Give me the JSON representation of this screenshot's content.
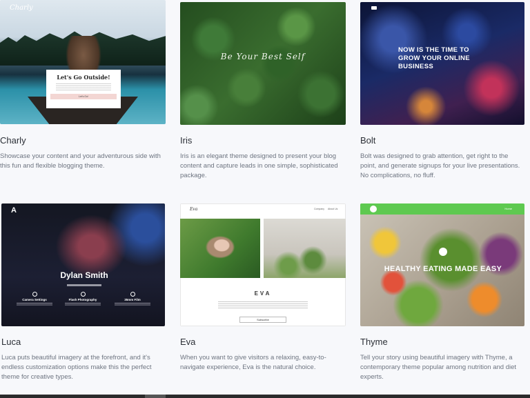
{
  "themes": [
    {
      "name": "Charly",
      "description": "Showcase your content and your adventurous side with this fun and flexible blogging theme.",
      "preview": {
        "logo": "Charly",
        "headline": "Let's Go Outside!",
        "button": "Let's Go!"
      }
    },
    {
      "name": "Iris",
      "description": "Iris is an elegant theme designed to present your blog content and capture leads in one simple, sophisticated package.",
      "preview": {
        "headline": "Be Your Best Self"
      }
    },
    {
      "name": "Bolt",
      "description": "Bolt was designed to grab attention, get right to the point, and generate signups for your live presentations. No complications, no fluff.",
      "preview": {
        "headline": "NOW IS THE TIME TO GROW YOUR ONLINE BUSINESS"
      }
    },
    {
      "name": "Luca",
      "description": "Luca puts beautiful imagery at the forefront, and it's endless customization options make this the perfect theme for creative types.",
      "preview": {
        "logo": "A",
        "headline": "Dylan Smith",
        "features": [
          "Camera Settings",
          "Flash Photography",
          "35mm Film"
        ]
      }
    },
    {
      "name": "Eva",
      "description": "When you want to give visitors a relaxing, easy-to-navigate experience, Eva is the natural choice.",
      "preview": {
        "logo": "Eva",
        "nav": [
          "Company",
          "About Us"
        ],
        "headline": "EVA",
        "button": "Subscribe"
      }
    },
    {
      "name": "Thyme",
      "description": "Tell your story using beautiful imagery with Thyme, a contemporary theme popular among nutrition and diet experts.",
      "preview": {
        "headline": "HEALTHY EATING MADE EASY",
        "nav": "Home"
      }
    }
  ]
}
